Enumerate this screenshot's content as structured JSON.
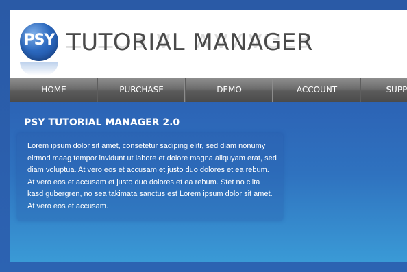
{
  "header": {
    "logo_text": "PSY",
    "brand": "TUTORIAL MANAGER"
  },
  "nav": {
    "items": [
      {
        "label": "HOME"
      },
      {
        "label": "PURCHASE"
      },
      {
        "label": "DEMO"
      },
      {
        "label": "ACCOUNT"
      },
      {
        "label": "SUPPORT"
      }
    ]
  },
  "main": {
    "title": "PSY TUTORIAL MANAGER 2.0",
    "body": "Lorem ipsum dolor sit amet, consetetur sadiping elitr, sed diam nonumy eirmod maag tempor invidunt ut labore et dolore magna aliquyam erat, sed diam voluptua. At vero eos et accusam et justo duo dolores et ea rebum. At vero eos et accusam et justo duo dolores et ea rebum. Stet no clita kasd gubergren, no sea takimata sanctus est Lorem ipsum dolor sit amet. At vero eos et accusam."
  },
  "colors": {
    "page_bg": "#2a5aa6",
    "nav_bg": "#6c6c6c",
    "brand_text": "#4a4a4a",
    "content_top": "#2c63b5",
    "content_bottom": "#3a9ad6"
  }
}
